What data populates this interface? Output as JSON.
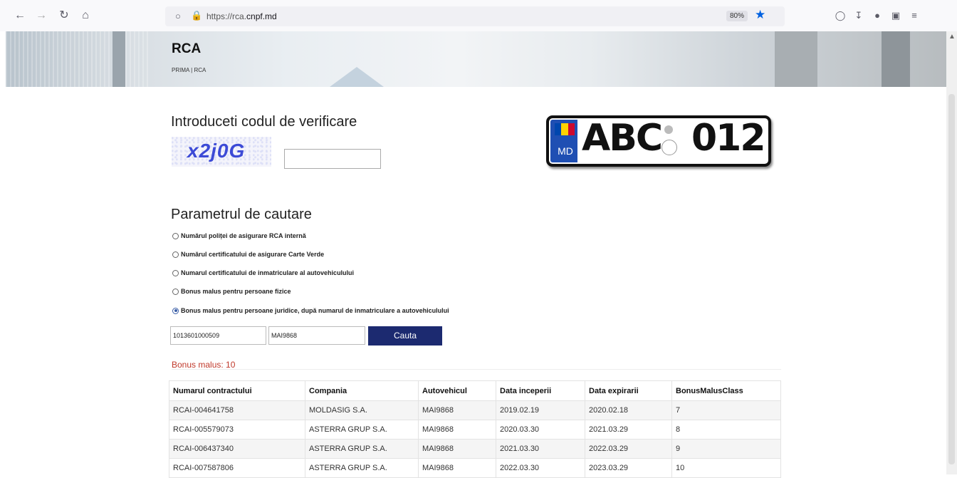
{
  "browser": {
    "url_prefix": "https://rca.",
    "url_domain": "cnpf.md",
    "zoom": "80%"
  },
  "hero": {
    "title": "RCA",
    "breadcrumb_home": "PRIMA",
    "breadcrumb_sep": " | ",
    "breadcrumb_current": "RCA"
  },
  "captcha": {
    "heading": "Introduceti codul de verificare",
    "code": "x2j0G",
    "input_value": ""
  },
  "plate": {
    "country": "MD",
    "letters": "ABC",
    "digits": "012",
    "flag_colors": [
      "#0046ae",
      "#ffd200",
      "#cc092f"
    ]
  },
  "search": {
    "heading": "Parametrul de cautare",
    "options": [
      {
        "label": "Numărul poliței de asigurare RCA internă",
        "selected": false
      },
      {
        "label": "Numărul certificatului de asigurare Carte Verde",
        "selected": false
      },
      {
        "label": "Numarul certificatului de inmatriculare al autovehiculului",
        "selected": false
      },
      {
        "label": "Bonus malus pentru persoane fizice",
        "selected": false
      },
      {
        "label": "Bonus malus pentru persoane juridice, după numarul de inmatriculare a autovehiculului",
        "selected": true
      }
    ],
    "field1_value": "1013601000509",
    "field2_value": "MAI9868",
    "button": "Cauta"
  },
  "result": {
    "bonus_malus": "Bonus malus: 10"
  },
  "table": {
    "headers": [
      "Numarul contractului",
      "Compania",
      "Autovehicul",
      "Data inceperii",
      "Data expirarii",
      "BonusMalusClass"
    ],
    "rows": [
      [
        "RCAI-004641758",
        "MOLDASIG S.A.",
        "MAI9868",
        "2019.02.19",
        "2020.02.18",
        "7"
      ],
      [
        "RCAI-005579073",
        "ASTERRA GRUP S.A.",
        "MAI9868",
        "2020.03.30",
        "2021.03.29",
        "8"
      ],
      [
        "RCAI-006437340",
        "ASTERRA GRUP S.A.",
        "MAI9868",
        "2021.03.30",
        "2022.03.29",
        "9"
      ],
      [
        "RCAI-007587806",
        "ASTERRA GRUP S.A.",
        "MAI9868",
        "2022.03.30",
        "2023.03.29",
        "10"
      ]
    ]
  }
}
